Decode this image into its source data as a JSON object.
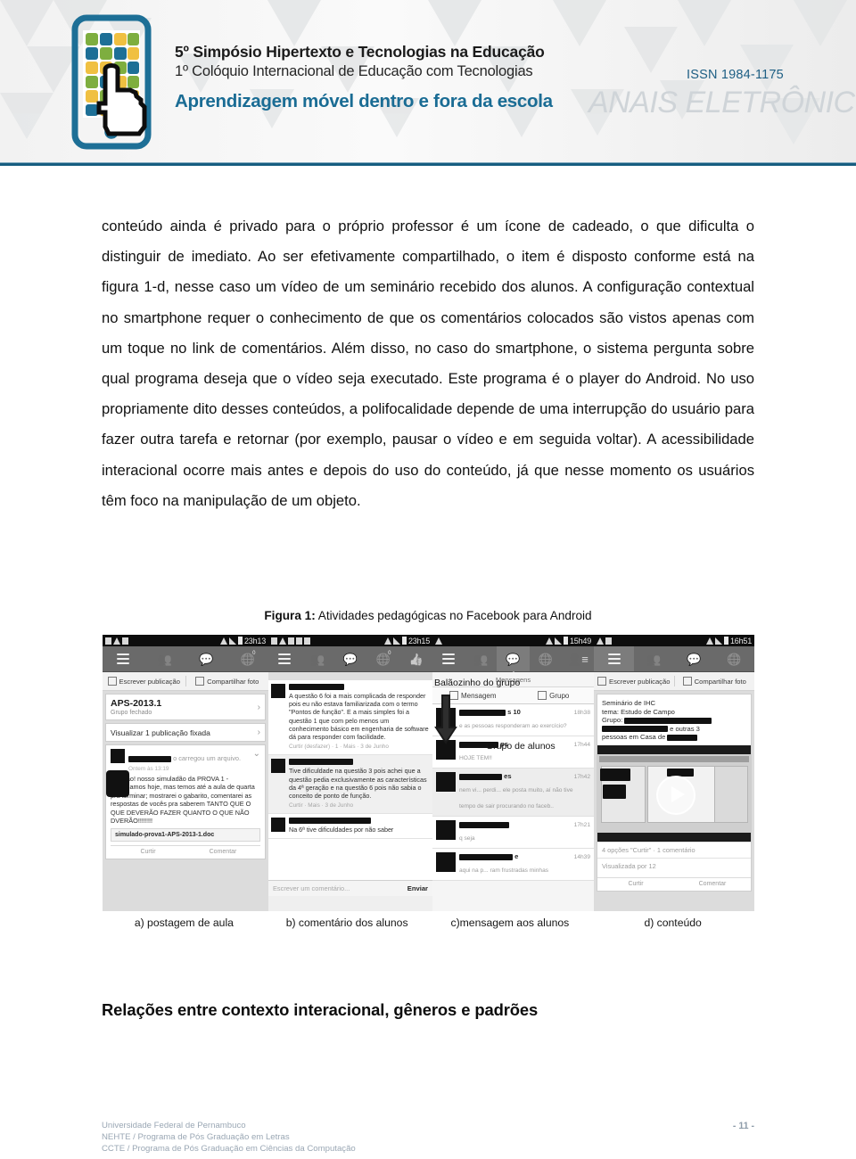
{
  "banner": {
    "title_line1": "5º Simpósio Hipertexto e Tecnologias na Educação",
    "title_line2": "1º Colóquio Internacional de Educação com Tecnologias",
    "title_line3": "Aprendizagem móvel dentro e fora da escola",
    "issn": "ISSN 1984-1175",
    "anais": "ANAIS ELETRÔNICOS",
    "accent_color": "#165d80",
    "title_accent_color": "#1a6c94",
    "anais_color": "#cfd4d8",
    "logo_icon": "smartphone-with-hand-cursor-icon"
  },
  "body": {
    "paragraph": "conteúdo ainda é privado para o próprio professor é um ícone de cadeado, o que dificulta o distinguir de imediato. Ao ser efetivamente compartilhado, o item é disposto conforme está na figura 1-d, nesse caso um vídeo de um seminário recebido dos alunos. A configuração contextual no smartphone requer o conhecimento de que os comentários colocados são vistos apenas com um toque no link de comentários. Além disso, no caso do smartphone, o sistema pergunta sobre qual programa deseja que o vídeo seja executado. Este programa é o player do Android. No uso propriamente dito desses conteúdos, a polifocalidade depende de uma interrupção do usuário para fazer outra tarefa e retornar (por exemplo, pausar o vídeo e em seguida voltar). A acessibilidade interacional ocorre mais antes e depois do uso do conteúdo, já que nesse momento os usuários têm foco na manipulação de um objeto."
  },
  "figure": {
    "caption_label": "Figura 1:",
    "caption_text": " Atividades pedagógicas no Facebook para Android",
    "labels": [
      "a) postagem de aula",
      "b) comentário dos alunos",
      "c)mensagem aos alunos",
      "d) conteúdo"
    ],
    "panel_a": {
      "status_time": "23h13",
      "action_write": "Escrever publicação",
      "action_share": "Compartilhar foto",
      "group_name": "APS-2013.1",
      "group_type": "Grupo fechado",
      "pinned": "Visualizar 1 publicação fixada",
      "post_author_suffix": "o carregou um arquivo.",
      "post_time": "Ontem às 13:19",
      "post_body": "atenção! nosso simuladão da PROVA 1 - começamos hoje, mas temos até a aula de quarta pra terminar; mostrarei o gabarito, comentarei as respostas de vocês pra saberem TANTO QUE O QUE DEVERÃO FAZER QUANTO O QUE NÃO DVERÃO!!!!!!!!",
      "attachment": "simulado-prova1-APS-2013-1.doc",
      "like": "Curtir",
      "comment": "Comentar"
    },
    "panel_b": {
      "status_time": "23h15",
      "comment_1": "A questão 6 foi a mais complicada de responder pois eu não estava familiarizada com o termo \"Pontos de função\". E a mais simples foi a questão 1 que com pelo menos um conhecimento básico em engenharia de software dá para responder com facilidade.",
      "comment_1_actions": "Curtir (desfazer) · 1 · Mais · 3 de Junho",
      "comment_2": "Tive dificuldade na questão 3 pois achei que a questão pedia exclusivamente as características da 4ª geração e na questão 6 pois não sabia o conceito de ponto de função.",
      "comment_2_actions": "Curtir · Mais · 3 de Junho",
      "comment_3": "Na 6ª tive dificuldades por não saber",
      "composer_placeholder": "Escrever um comentário...",
      "send_label": "Enviar"
    },
    "panel_c": {
      "status_time": "15h49",
      "annotation_balloon": "Balãozinho do grupo",
      "annotation_group": "Grupo de alunos",
      "dropdown_title": "Mensagens",
      "tab_message": "Mensagem",
      "tab_group": "Grupo",
      "rows": [
        {
          "name": "s 10",
          "time": "18h38",
          "snippet": "e as pessoas responderam ao exercício?"
        },
        {
          "name": "ps",
          "time": "17h44",
          "snippet": "HOJE TEM!!"
        },
        {
          "name": "es",
          "time": "17h42",
          "snippet": "nem vi... perdi... ele posta muito, aí não tive tempo de sair procurando no faceb.."
        },
        {
          "name": "",
          "time": "17h21",
          "snippet": "q seja"
        },
        {
          "name": "e",
          "time": "14h39",
          "snippet": "aqui na p... ram frustradas minhas"
        }
      ]
    },
    "panel_d": {
      "status_time": "16h51",
      "action_write": "Escrever publicação",
      "action_share": "Compartilhar foto",
      "post_line1": "Seminário de IHC",
      "post_line2": "tema: Estudo de Campo",
      "post_line3": "Grupo:",
      "post_line4": "e outras 3",
      "post_line5": "pessoas em Casa de",
      "play_icon": "play-button-icon",
      "meta_likes": "4 opções \"Curtir\" · 1 comentário",
      "meta_views": "Visualizada por 12",
      "like": "Curtir",
      "comment": "Comentar"
    }
  },
  "section": {
    "heading": "Relações entre contexto interacional, gêneros e padrões"
  },
  "footer": {
    "line1": "Universidade Federal de Pernambuco",
    "line2": "NEHTE / Programa de Pós Graduação em Letras",
    "line3": "CCTE / Programa de Pós Graduação em Ciências da Computação",
    "page": "- 11 -"
  }
}
